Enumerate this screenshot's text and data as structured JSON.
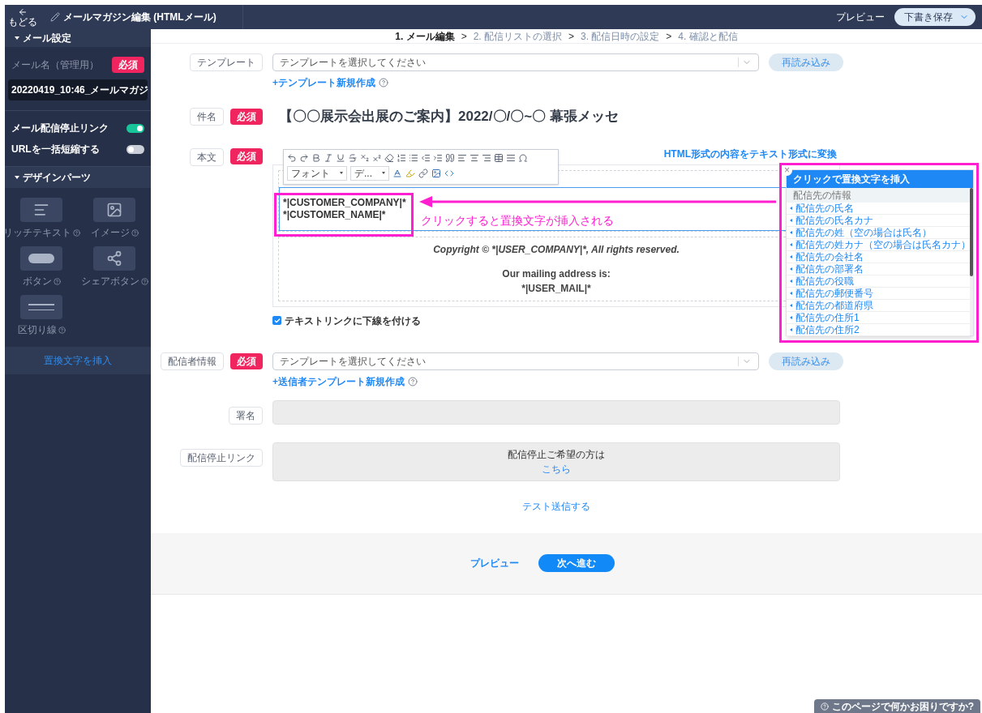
{
  "header": {
    "back_label": "もどる",
    "title": "メールマガジン編集 (HTMLメール)",
    "preview": "プレビュー",
    "save": "下書き保存"
  },
  "sidebar": {
    "mail_settings": {
      "heading": "メール設定",
      "expanded": true,
      "name_label": "メール名（管理用）",
      "required": "必須",
      "name_value": "20220419_10:46_メールマガジ"
    },
    "toggles": [
      {
        "label": "メール配信停止リンク",
        "on": true
      },
      {
        "label": "URLを一括短縮する",
        "on": false
      }
    ],
    "design_parts": {
      "heading": "デザインパーツ",
      "expanded": true,
      "items": [
        {
          "kind": "richtext",
          "label": "リッチテキスト"
        },
        {
          "kind": "image",
          "label": "イメージ"
        },
        {
          "kind": "button",
          "label": "ボタン"
        },
        {
          "kind": "share",
          "label": "シェアボタン"
        },
        {
          "kind": "divider",
          "label": "区切り線"
        }
      ]
    },
    "insert_link": "置換文字を挿入"
  },
  "steps": [
    {
      "label": "1. メール編集",
      "selected": true
    },
    {
      "label": "2. 配信リストの選択",
      "selected": false
    },
    {
      "label": "3. 配信日時の設定",
      "selected": false
    },
    {
      "label": "4. 確認と配信",
      "selected": false
    }
  ],
  "step_separator": ">",
  "template": {
    "label": "テンプレート",
    "placeholder": "テンプレートを選択してください",
    "reload": "再読み込み",
    "new_link": "+テンプレート新規作成"
  },
  "subject": {
    "label": "件名",
    "required": "必須",
    "value": "【〇〇展示会出展のご案内】2022/〇/〇~〇 幕張メッセ"
  },
  "body": {
    "label": "本文",
    "required": "必須",
    "convert_link": "HTML形式の内容をテキスト形式に変換",
    "toolbar": {
      "font": "フォント",
      "size": "デ..."
    },
    "content_lines": [
      "*|CUSTOMER_COMPANY|*",
      "*|CUSTOMER_NAME|*"
    ],
    "footer_lines": [
      {
        "text": "Copyright © *|USER_COMPANY|*, All rights reserved.",
        "italic": true
      },
      {
        "text": "Our mailing address is:",
        "italic": false
      },
      {
        "text": "*|USER_MAIL|*",
        "italic": false
      }
    ],
    "underline_links": {
      "label": "テキストリンクに下線を付ける",
      "checked": true
    }
  },
  "annotation": "クリックすると置換文字が挿入される",
  "popup": {
    "title": "クリックで置換文字を挿入",
    "close": "×",
    "section": "配信先の情報",
    "items": [
      "配信先の氏名",
      "配信先の氏名カナ",
      "配信先の姓（空の場合は氏名）",
      "配信先の姓カナ（空の場合は氏名カナ）",
      "配信先の会社名",
      "配信先の部署名",
      "配信先の役職",
      "配信先の郵便番号",
      "配信先の都道府県",
      "配信先の住所1",
      "配信先の住所2"
    ]
  },
  "sender": {
    "label": "配信者情報",
    "required": "必須",
    "placeholder": "テンプレートを選択してください",
    "reload": "再読み込み",
    "new_link": "+送信者テンプレート新規作成"
  },
  "signature": {
    "label": "署名"
  },
  "unsubscribe": {
    "label": "配信停止リンク",
    "text": "配信停止ご希望の方は",
    "link": "こちら"
  },
  "test_send": "テスト送信する",
  "footer": {
    "preview": "プレビュー",
    "next": "次へ進む"
  },
  "help": "このページで何かお困りですか?"
}
